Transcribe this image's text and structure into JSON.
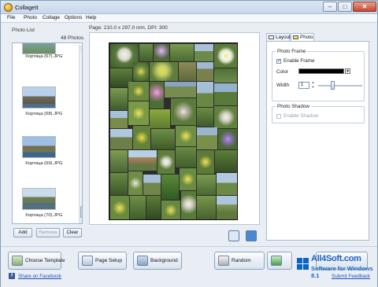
{
  "app": {
    "title": "CollageIt"
  },
  "window_controls": {
    "minimize": "–",
    "maximize": "□",
    "close": "✕"
  },
  "menu": [
    "File",
    "Photo",
    "Collage",
    "Options",
    "Help"
  ],
  "page_info": "Page: 210.0 x 297.0 mm, DPI: 300",
  "photo_list": {
    "title": "Photo List",
    "count": "48 Photos",
    "items": [
      {
        "label": "Хортица (67).JPG"
      },
      {
        "label": "Хортица (68).JPG"
      },
      {
        "label": "Хортица (69).JPG"
      },
      {
        "label": "Хортица (70).JPG"
      }
    ],
    "add_label": "Add",
    "remove_label": "Remove",
    "clear_label": "Clear"
  },
  "tabs": [
    {
      "label": "Layout",
      "icon": "layout-icon"
    },
    {
      "label": "Photo",
      "icon": "photo-icon"
    }
  ],
  "photo_frame": {
    "title": "Photo Frame",
    "enable_label": "Enable Frame",
    "enable_checked": true,
    "color_label": "Color",
    "color_value": "#000000",
    "width_label": "Width",
    "width_value": "1"
  },
  "photo_shadow": {
    "title": "Photo Shadow",
    "enable_label": "Enable Shadow",
    "enable_checked": false
  },
  "bottom": {
    "choose_template": "Choose Template",
    "page_setup": "Page Setup",
    "background": "Background",
    "random": "Random"
  },
  "links": {
    "facebook": "Share on Facebook",
    "feedback": "Submit Feedback"
  },
  "watermark": {
    "site": "All4Soft.com",
    "sub": "Software for Windows 8.1"
  },
  "colors": {
    "accent": "#1e62c4",
    "window_bg": "#e9eef5",
    "frame_color": "#000000"
  }
}
